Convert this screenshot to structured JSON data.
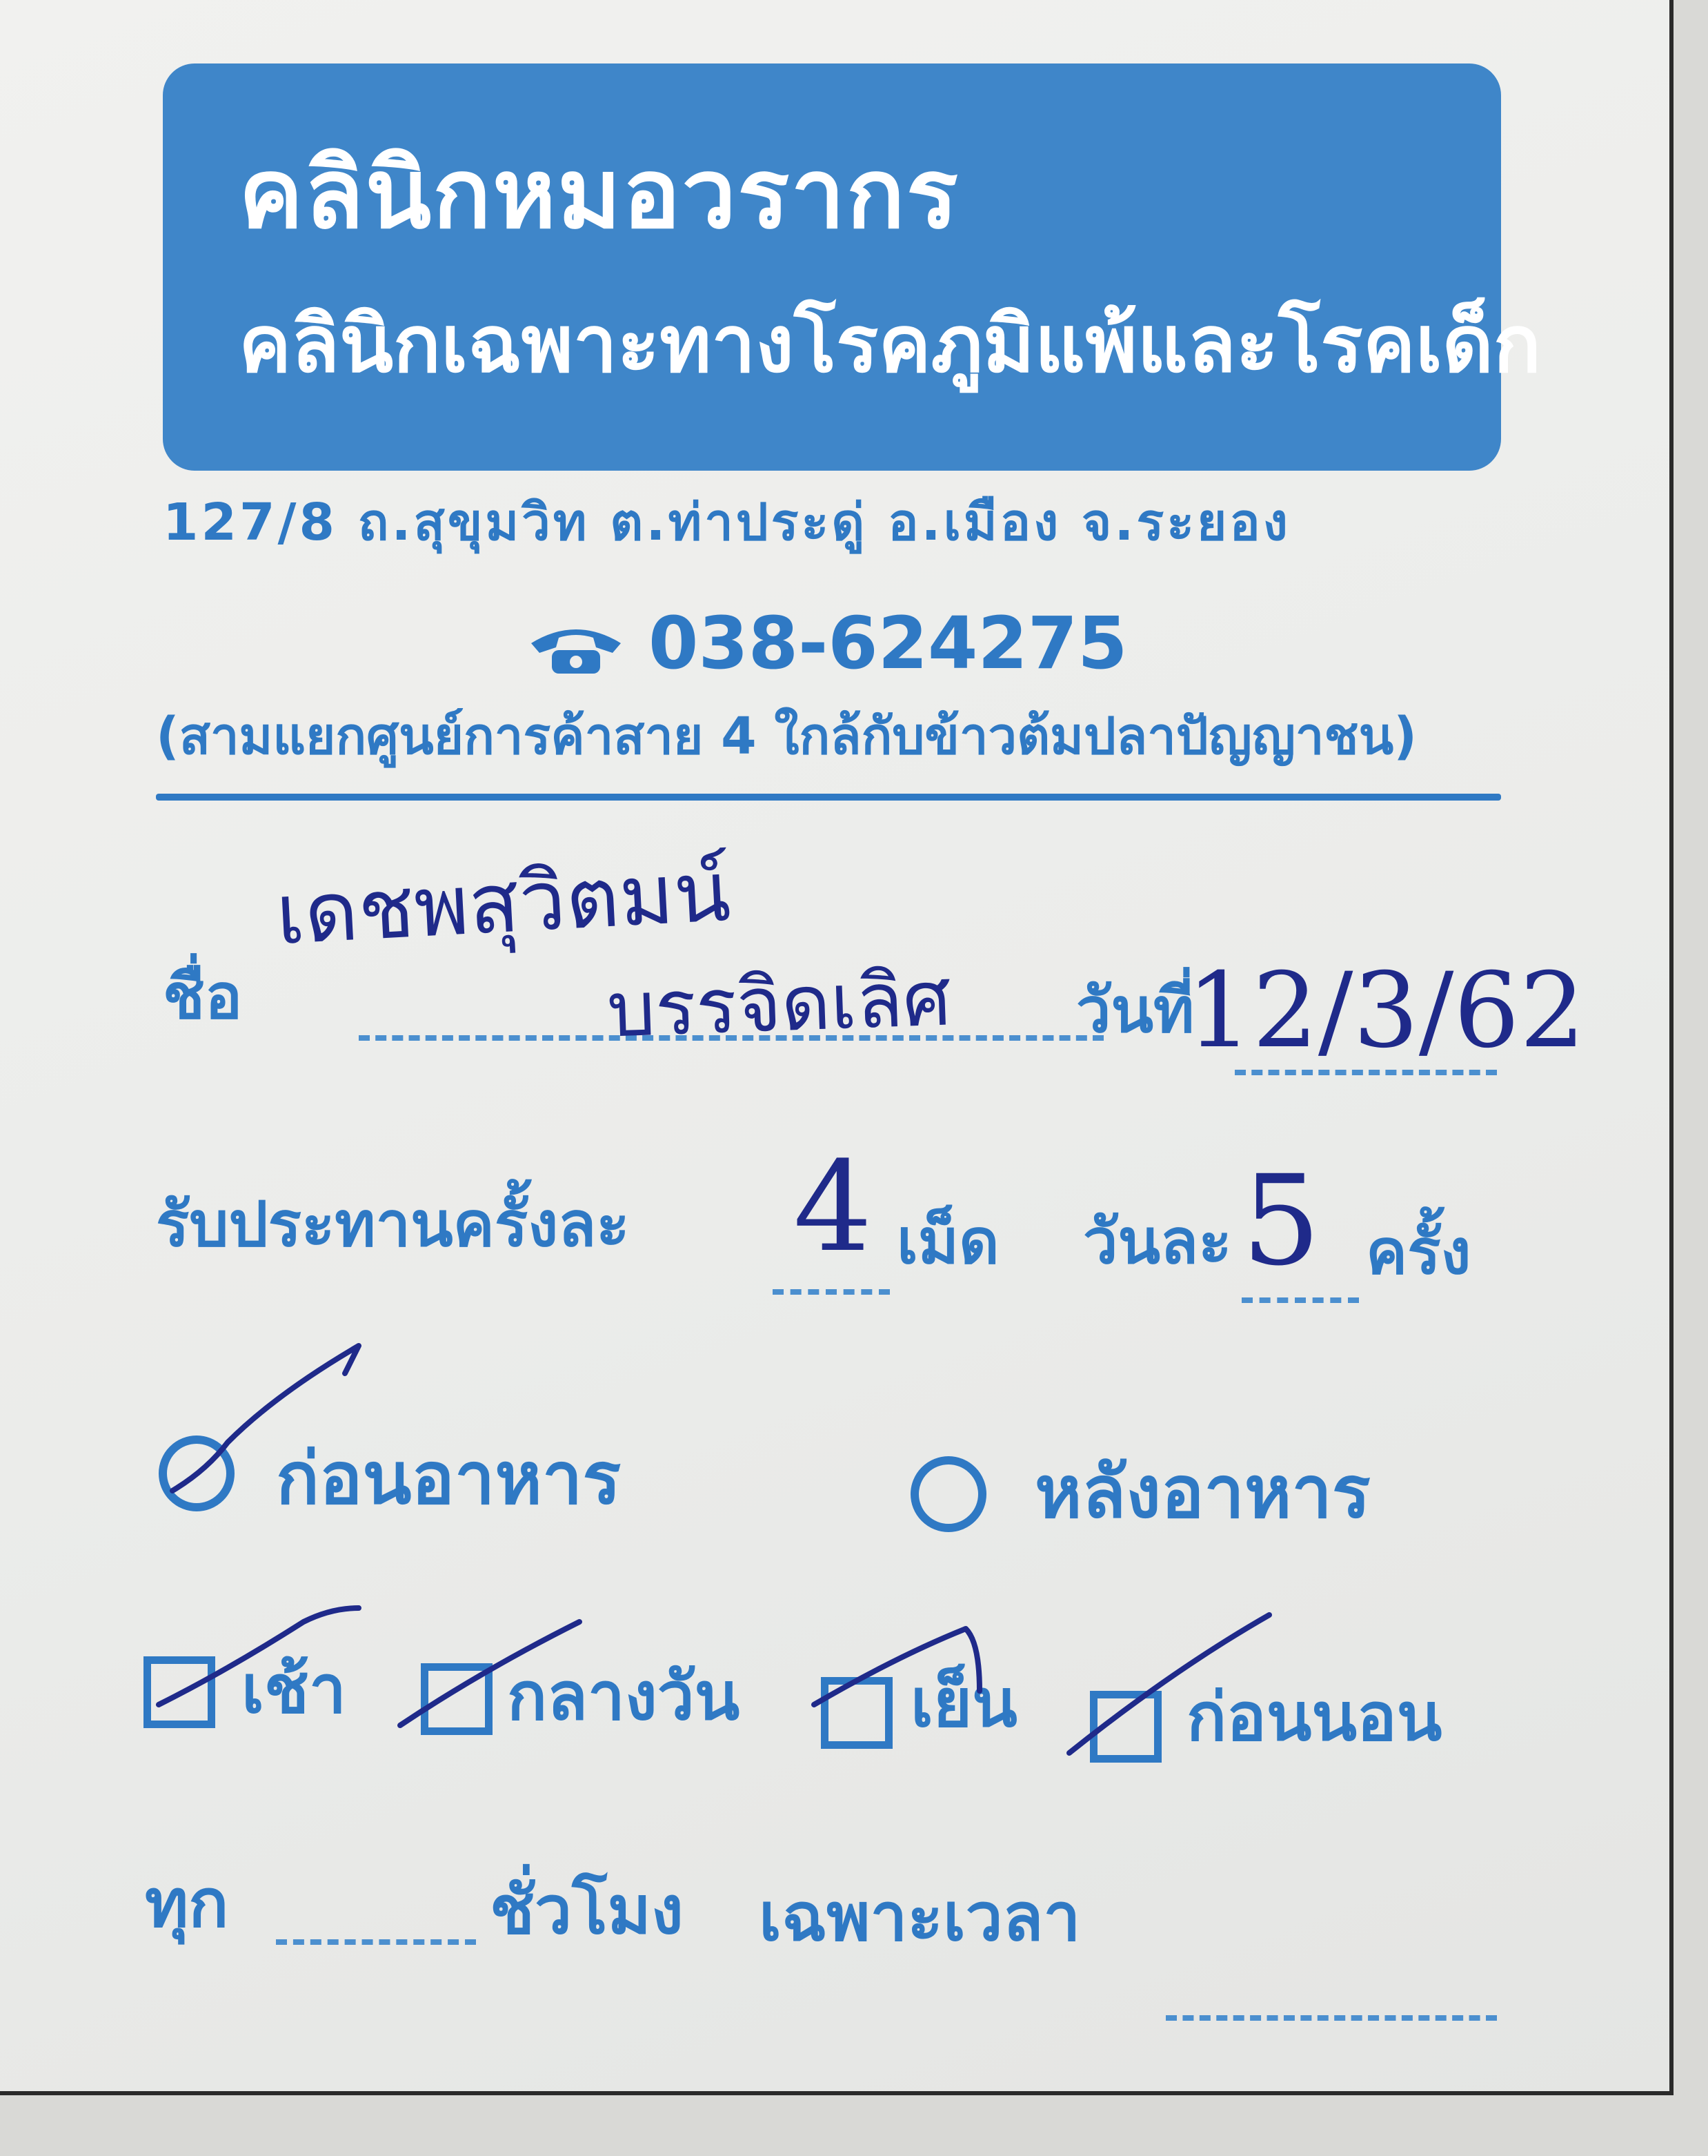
{
  "clinic": {
    "name": "คลินิกหมอวรากร",
    "specialty": "คลินิกเฉพาะทางโรคภูมิแพ้และโรคเด็ก",
    "address": "127/8 ถ.สุขุมวิท ต.ท่าประดู่ อ.เมือง จ.ระยอง",
    "phone": "038-624275",
    "directions": "(สามแยกศูนย์การค้าสาย 4 ใกล้กับข้าวต้มปลาปัญญาชน)",
    "phone_icon": "phone-icon"
  },
  "form": {
    "name_label": "ชื่อ",
    "name_value_line1": "เดชพสุวิตมน์",
    "name_value_line2": "บรรจิดเลิศ",
    "date_label": "วันที่",
    "date_value": "12/3/62",
    "dose_label": "รับประทานครั้งละ",
    "dose_value": "4",
    "dose_unit": "เม็ด",
    "freq_label": "วันละ",
    "freq_value": "5",
    "freq_unit": "ครั้ง",
    "before_meal": "ก่อนอาหาร",
    "after_meal": "หลังอาหาร",
    "before_meal_checked": true,
    "after_meal_checked": false,
    "times": [
      {
        "label": "เช้า",
        "checked": true
      },
      {
        "label": "กลางวัน",
        "checked": true
      },
      {
        "label": "เย็น",
        "checked": true
      },
      {
        "label": "ก่อนนอน",
        "checked": true
      }
    ],
    "every_label": "ทุก",
    "hours_label": "ชั่วโมง",
    "specific_time_label": "เฉพาะเวลา"
  },
  "colors": {
    "brand_blue": "#3f86c9",
    "ink": "#1f2a8a"
  }
}
